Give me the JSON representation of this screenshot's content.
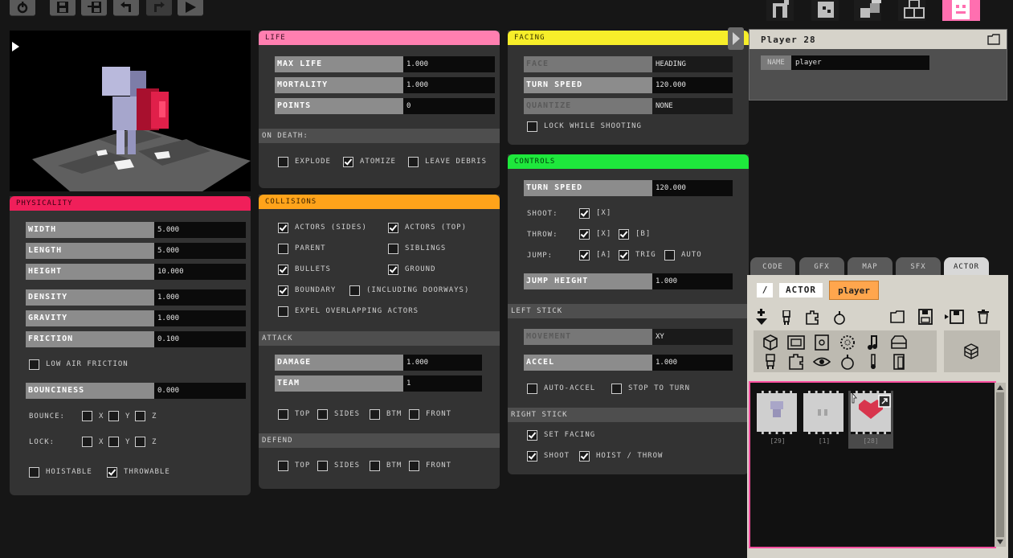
{
  "toolbar": {
    "left_icons": [
      "power-icon",
      "save-icon",
      "save-as-icon",
      "undo-icon",
      "redo-icon",
      "play-icon"
    ],
    "right_icons": [
      "room-icon",
      "block-icon",
      "blocks-icon",
      "world-icon",
      "actor-icon"
    ]
  },
  "colors": {
    "life": "#ff7fb0",
    "facing": "#f7ee2a",
    "controls": "#1ee83c",
    "physicality": "#f01f5a",
    "collisions": "#ffa31a",
    "accent": "#ff6fb0",
    "orange": "#ffa64d"
  },
  "physicality": {
    "header": "PHYSICALITY",
    "fields": [
      {
        "label": "WIDTH",
        "value": "5.000"
      },
      {
        "label": "LENGTH",
        "value": "5.000"
      },
      {
        "label": "HEIGHT",
        "value": "10.000"
      },
      {
        "label": "DENSITY",
        "value": "1.000"
      },
      {
        "label": "GRAVITY",
        "value": "1.000"
      },
      {
        "label": "FRICTION",
        "value": "0.100"
      }
    ],
    "low_air_friction": "LOW AIR FRICTION",
    "bounciness": {
      "label": "BOUNCINESS",
      "value": "0.000"
    },
    "bounce_label": "BOUNCE:",
    "lock_label": "LOCK:",
    "axes": [
      "X",
      "Y",
      "Z"
    ],
    "hoistable": "HOISTABLE",
    "throwable": "THROWABLE"
  },
  "life": {
    "header": "LIFE",
    "fields": [
      {
        "label": "MAX LIFE",
        "value": "1.000"
      },
      {
        "label": "MORTALITY",
        "value": "1.000"
      },
      {
        "label": "POINTS",
        "value": "0"
      }
    ],
    "on_death": "ON DEATH:",
    "explode": "EXPLODE",
    "atomize": "ATOMIZE",
    "leave_debris": "LEAVE DEBRIS"
  },
  "collisions": {
    "header": "COLLISIONS",
    "actors_sides": "ACTORS (SIDES)",
    "actors_top": "ACTORS (TOP)",
    "parent": "PARENT",
    "siblings": "SIBLINGS",
    "bullets": "BULLETS",
    "ground": "GROUND",
    "boundary": "BOUNDARY",
    "including_doorways": "(INCLUDING DOORWAYS)",
    "expel": "EXPEL OVERLAPPING ACTORS"
  },
  "attack": {
    "header": "ATTACK",
    "damage": {
      "label": "DAMAGE",
      "value": "1.000"
    },
    "team": {
      "label": "TEAM",
      "value": "1"
    },
    "top": "TOP",
    "sides": "SIDES",
    "btm": "BTM",
    "front": "FRONT"
  },
  "defend": {
    "header": "DEFEND",
    "top": "TOP",
    "sides": "SIDES",
    "btm": "BTM",
    "front": "FRONT"
  },
  "facing": {
    "header": "FACING",
    "face": {
      "label": "FACE",
      "value": "HEADING"
    },
    "turn_speed": {
      "label": "TURN SPEED",
      "value": "120.000"
    },
    "quantize": {
      "label": "QUANTIZE",
      "value": "NONE"
    },
    "lock_while_shooting": "LOCK WHILE SHOOTING"
  },
  "controls": {
    "header": "CONTROLS",
    "turn_speed": {
      "label": "TURN SPEED",
      "value": "120.000"
    },
    "shoot_label": "SHOOT:",
    "throw_label": "THROW:",
    "jump_label": "JUMP:",
    "btn_x": "[X]",
    "btn_b": "[B]",
    "btn_a": "[A]",
    "trig": "TRIG",
    "auto": "AUTO",
    "jump_height": {
      "label": "JUMP HEIGHT",
      "value": "1.000"
    }
  },
  "left_stick": {
    "header": "LEFT STICK",
    "movement": {
      "label": "MOVEMENT",
      "value": "XY"
    },
    "accel": {
      "label": "ACCEL",
      "value": "1.000"
    },
    "auto_accel": "AUTO-ACCEL",
    "stop_to_turn": "STOP TO TURN"
  },
  "right_stick": {
    "header": "RIGHT STICK",
    "set_facing": "SET FACING",
    "shoot": "SHOOT",
    "hoist_throw": "HOIST / THROW"
  },
  "player_panel": {
    "title": "Player 28",
    "name_label": "NAME",
    "name_value": "player"
  },
  "library": {
    "tabs": [
      "CODE",
      "GFX",
      "MAP",
      "SFX",
      "ACTOR"
    ],
    "active_tab": "ACTOR",
    "path_root": "/",
    "path_actor": "ACTOR",
    "path_player": "player",
    "thumbs": [
      {
        "caption": "[29]"
      },
      {
        "caption": "[1]"
      },
      {
        "caption": "[28]"
      }
    ]
  }
}
